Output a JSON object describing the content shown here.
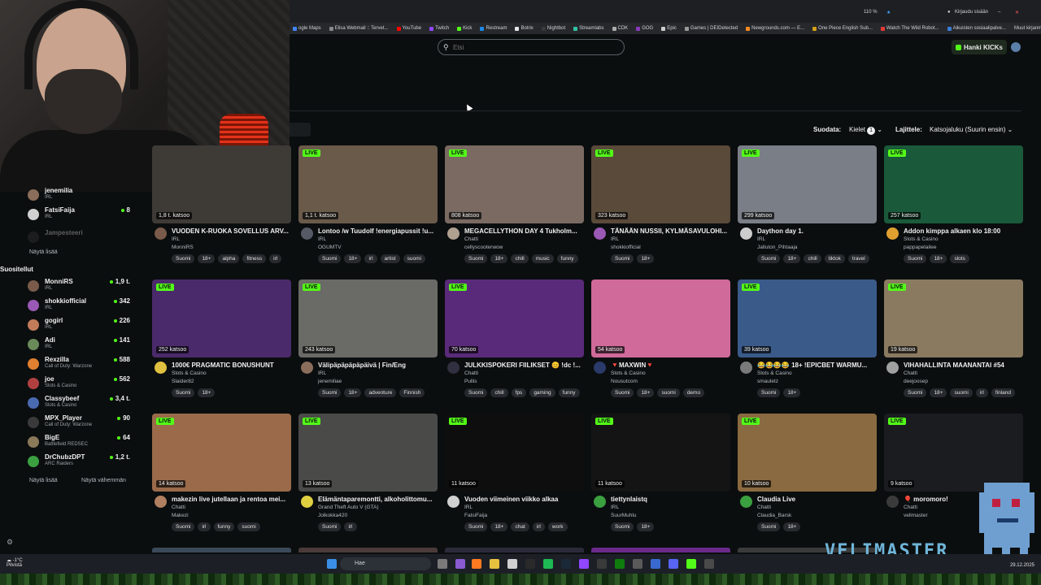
{
  "browser": {
    "zoom": "110 %",
    "signin": "Kirjaudu sisään",
    "bookmarks": [
      {
        "label": "ogle Maps",
        "color": "#4285f4"
      },
      {
        "label": "Elisa Webmail :: Tervet...",
        "color": "#888888"
      },
      {
        "label": "YouTube",
        "color": "#ff0000"
      },
      {
        "label": "Twitch",
        "color": "#9146ff"
      },
      {
        "label": "Kick",
        "color": "#53fc18"
      },
      {
        "label": "Restream",
        "color": "#1e88e5"
      },
      {
        "label": "Botrix",
        "color": "#e5e5e5"
      },
      {
        "label": "Nightbot",
        "color": "#3a3a3a"
      },
      {
        "label": "Streamlabs",
        "color": "#31c3a2"
      },
      {
        "label": "CDK",
        "color": "#aaaaaa"
      },
      {
        "label": "GOG",
        "color": "#8a3ab9"
      },
      {
        "label": "Epic",
        "color": "#cccccc"
      },
      {
        "label": "Games | DEIDetected",
        "color": "#999999"
      },
      {
        "label": "Newgrounds.com — E...",
        "color": "#f58a1f"
      },
      {
        "label": "One Piece English Sub...",
        "color": "#d4a017"
      },
      {
        "label": "Watch The Wild Robot...",
        "color": "#e53935"
      },
      {
        "label": "Aikuisten sosiaalipalve...",
        "color": "#3b7dd8"
      }
    ],
    "other_bookmarks": "Muut kirjanmerkit"
  },
  "header": {
    "search_placeholder": "Etsi",
    "get_kicks": "Hanki KICKs"
  },
  "controls": {
    "sort_label": "Suodata:",
    "languages_label": "Kielet",
    "languages_count": "1",
    "order_label": "Lajittele:",
    "order_value": "Katsojaluku (Suurin ensin)"
  },
  "sidebar": {
    "top_items": [
      {
        "name": "jenemilia",
        "category": "IRL",
        "viewers": "",
        "color": "#8a6d5b"
      },
      {
        "name": "FatsiFaija",
        "category": "IRL",
        "viewers": "8",
        "color": "#d0d0d0"
      },
      {
        "name": "Jampesteeri",
        "category": "",
        "viewers": "",
        "color": "#3a3a3a"
      }
    ],
    "show_more_top": "Näytä lisää",
    "recommended_heading": "Suositellut",
    "recommended": [
      {
        "name": "MonniRS",
        "category": "IRL",
        "viewers": "1,9 t.",
        "color": "#7a5a4a"
      },
      {
        "name": "shokkiofficial",
        "category": "IRL",
        "viewers": "342",
        "color": "#9b59b6"
      },
      {
        "name": "gogirl",
        "category": "IRL",
        "viewers": "226",
        "color": "#c27c5a"
      },
      {
        "name": "Adi",
        "category": "IRL",
        "viewers": "141",
        "color": "#6a8a5a"
      },
      {
        "name": "Rexzilla",
        "category": "Call of Duty: Warzone",
        "viewers": "588",
        "color": "#e08030"
      },
      {
        "name": "joe",
        "category": "Slots & Casino",
        "viewers": "562",
        "color": "#b04040"
      },
      {
        "name": "Classybeef",
        "category": "Slots & Casino",
        "viewers": "3,4 t.",
        "color": "#4a6ab0"
      },
      {
        "name": "MPX_Player",
        "category": "Call of Duty: Warzone",
        "viewers": "90",
        "color": "#3a3a3a"
      },
      {
        "name": "BigE",
        "category": "Battlefield REDSEC",
        "viewers": "64",
        "color": "#8a7a5a"
      },
      {
        "name": "DrChubzDPT",
        "category": "ARC Raiders",
        "viewers": "1,2 t.",
        "color": "#3aa040"
      }
    ],
    "show_more": "Näytä lisää",
    "show_less": "Näytä vähemmän"
  },
  "streams": [
    {
      "title": "VUODEN K-RUOKA SOVELLUS ARV...",
      "category": "IRL",
      "channel": "MonniRS",
      "viewers": "1,8 t. katsoo",
      "tags": [
        "Suomi",
        "18+",
        "alpha",
        "fitness",
        "irl"
      ],
      "thumb": "#3e3a36",
      "avatar": "#7a5a4a",
      "live": ""
    },
    {
      "title": "Lontoo /w Tuudolf !energiapussit !u...",
      "category": "IRL",
      "channel": "OGUMTV",
      "viewers": "1,1 t. katsoo",
      "tags": [
        "Suomi",
        "18+",
        "irl",
        "artist",
        "suomi"
      ],
      "thumb": "#6a5a4a",
      "avatar": "#555a66",
      "live": "LIVE"
    },
    {
      "title": "MEGACELLYTHON DAY 4 Tukholm...",
      "category": "Chatti",
      "channel": "cellyscooterwow",
      "viewers": "808 katsoo",
      "tags": [
        "Suomi",
        "18+",
        "chill",
        "music",
        "funny"
      ],
      "thumb": "#7a6a62",
      "avatar": "#b0a090",
      "live": "LIVE"
    },
    {
      "title": "TÄNÄÄN NUSSII, KYLMÄSAVULOHI...",
      "category": "IRL",
      "channel": "shokkiofficial",
      "viewers": "323 katsoo",
      "tags": [
        "Suomi",
        "18+"
      ],
      "thumb": "#5a4a3a",
      "avatar": "#9b59b6",
      "live": "LIVE"
    },
    {
      "title": "Daython day 1.",
      "category": "IRL",
      "channel": "Jalluton_Pihtaaja",
      "viewers": "299 katsoo",
      "tags": [
        "Suomi",
        "18+",
        "chill",
        "tiktok",
        "travel"
      ],
      "thumb": "#7a7e86",
      "avatar": "#cccccc",
      "live": "LIVE"
    },
    {
      "title": "Addon kimppa alkaen klo 18:00",
      "category": "Slots & Casino",
      "channel": "pappapelailee",
      "viewers": "257 katsoo",
      "tags": [
        "Suomi",
        "18+",
        "slots"
      ],
      "thumb": "#1a5a3a",
      "avatar": "#e0a030",
      "live": "LIVE"
    },
    {
      "title": "1000€ PRAGMATIC BONUSHUNT",
      "category": "Slots & Casino",
      "channel": "Slaider82",
      "viewers": "252 katsoo",
      "tags": [
        "Suomi",
        "18+"
      ],
      "thumb": "#4a2a6a",
      "avatar": "#e0c040",
      "live": "LIVE"
    },
    {
      "title": "Välipäpäpäpäpäivä | Fin/Eng",
      "category": "IRL",
      "channel": "jenemiliae",
      "viewers": "243 katsoo",
      "tags": [
        "Suomi",
        "18+",
        "adventure",
        "Finnish"
      ],
      "thumb": "#6a6a66",
      "avatar": "#8a6d5b",
      "live": "LIVE"
    },
    {
      "title": "JULKKISPOKERI FIILIKSET 😊 !dc !...",
      "category": "Chatti",
      "channel": "Pullis",
      "viewers": "70 katsoo",
      "tags": [
        "Suomi",
        "chill",
        "fps",
        "gaming",
        "funny"
      ],
      "thumb": "#5a2a7a",
      "avatar": "#303040",
      "live": "LIVE"
    },
    {
      "title": "🔻MAXWIN🔻",
      "category": "Slots & Casino",
      "channel": "Nousutcom",
      "viewers": "54 katsoo",
      "tags": [
        "Suomi",
        "18+",
        "suomi",
        "demo"
      ],
      "thumb": "#d06a9a",
      "avatar": "#2a3a6a",
      "live": ""
    },
    {
      "title": "😂😂😂😂 18+ !EPICBET WARMU...",
      "category": "Slots & Casino",
      "channel": "smauletz",
      "viewers": "39 katsoo",
      "tags": [
        "Suomi",
        "18+"
      ],
      "thumb": "#3a5a8a",
      "avatar": "#7a7a7a",
      "live": "LIVE"
    },
    {
      "title": "VIHAHALLINTA MAANANTAI #54",
      "category": "Chatti",
      "channel": "deejoosep",
      "viewers": "19 katsoo",
      "tags": [
        "Suomi",
        "18+",
        "suomi",
        "irl",
        "finland"
      ],
      "thumb": "#8a7a60",
      "avatar": "#a0a0a0",
      "live": "LIVE"
    },
    {
      "title": "makezin live jutellaan ja rentoa mei...",
      "category": "Chatti",
      "channel": "Makezi",
      "viewers": "14 katsoo",
      "tags": [
        "Suomi",
        "irl",
        "funny",
        "suomi"
      ],
      "thumb": "#9a6a4a",
      "avatar": "#b08060",
      "live": "LIVE"
    },
    {
      "title": "Elämäntaparemontti, alkoholittomu...",
      "category": "Grand Theft Auto V (GTA)",
      "channel": "Jolkokka420",
      "viewers": "13 katsoo",
      "tags": [
        "Suomi",
        "irl"
      ],
      "thumb": "#4a4a48",
      "avatar": "#e0d040",
      "live": "LIVE"
    },
    {
      "title": "Vuoden viimeinen viikko alkaa",
      "category": "IRL",
      "channel": "FatsiFaija",
      "viewers": "11 katsoo",
      "tags": [
        "Suomi",
        "18+",
        "chat",
        "irl",
        "work"
      ],
      "thumb": "#0e0e0e",
      "avatar": "#d0d0d0",
      "live": "LIVE"
    },
    {
      "title": "tiettynlaistq",
      "category": "IRL",
      "channel": "SuurMuhlu",
      "viewers": "11 katsoo",
      "tags": [
        "Suomi",
        "18+"
      ],
      "thumb": "#141414",
      "avatar": "#3aa040",
      "live": "LIVE"
    },
    {
      "title": "Claudia Live",
      "category": "Chatti",
      "channel": "Claudia_Barsk",
      "viewers": "10 katsoo",
      "tags": [
        "Suomi",
        "18+"
      ],
      "thumb": "#8a6a40",
      "avatar": "#3aa040",
      "live": "LIVE"
    },
    {
      "title": "🎈 moromoro!",
      "category": "Chatti",
      "channel": "velimaster",
      "viewers": "9 katsoo",
      "tags": [],
      "thumb": "#1a1c20",
      "avatar": "#3a3a3a",
      "live": "LIVE"
    }
  ],
  "taskbar": {
    "weather_temp": "-1°C",
    "weather_desc": "Pilvistä",
    "search": "Hae",
    "date": "29.12.2025"
  },
  "overlay": {
    "brand": "VELIMASTER"
  }
}
